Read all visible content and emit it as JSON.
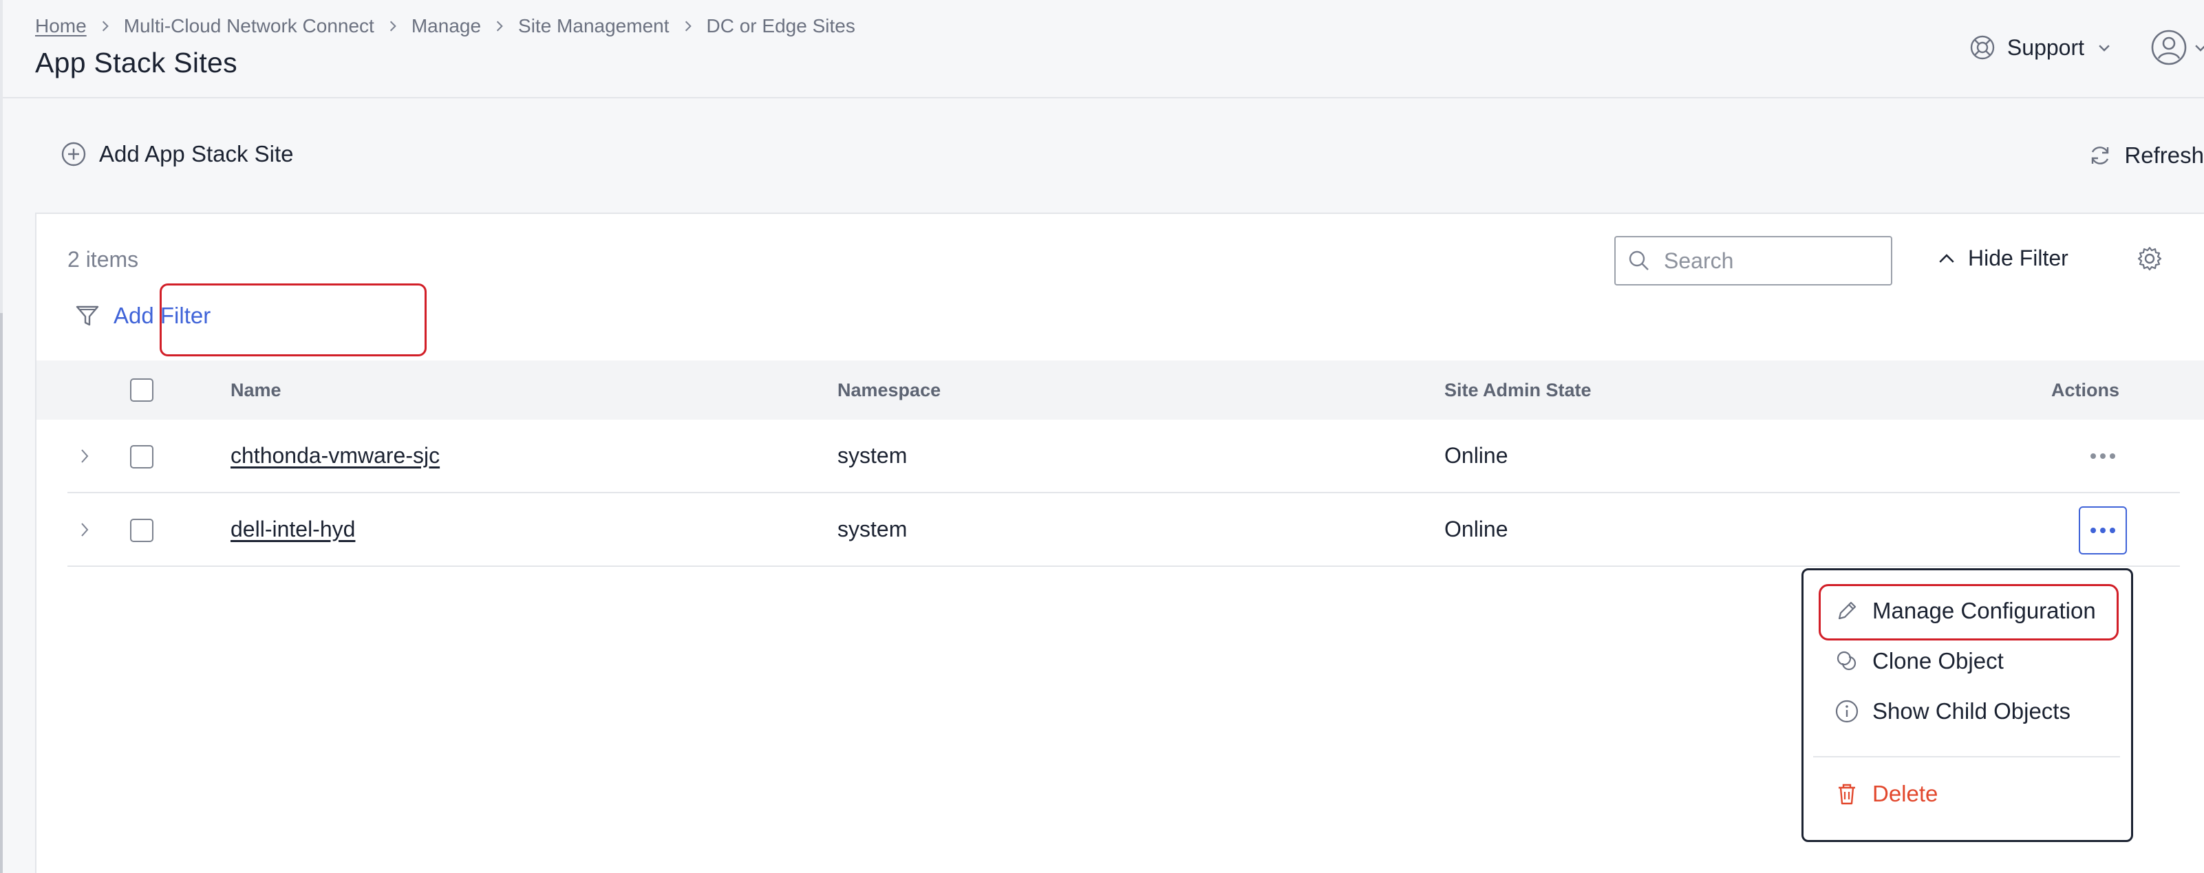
{
  "breadcrumb": {
    "items": [
      "Home",
      "Multi-Cloud Network Connect",
      "Manage",
      "Site Management",
      "DC or Edge Sites"
    ]
  },
  "page": {
    "title": "App Stack Sites"
  },
  "header": {
    "support_label": "Support"
  },
  "toolbar": {
    "add_label": "Add App Stack Site",
    "refresh_label": "Refresh"
  },
  "list": {
    "count_label": "2 items",
    "search_placeholder": "Search",
    "hide_filter_label": "Hide Filter",
    "add_filter_label": "Add Filter"
  },
  "table": {
    "columns": [
      "Name",
      "Namespace",
      "Site Admin State",
      "Actions"
    ],
    "rows": [
      {
        "name": "chthonda-vmware-sjc",
        "namespace": "system",
        "state": "Online"
      },
      {
        "name": "dell-intel-hyd",
        "namespace": "system",
        "state": "Online"
      }
    ]
  },
  "menu": {
    "items": [
      "Manage Configuration",
      "Clone Object",
      "Show Child Objects",
      "Delete"
    ]
  },
  "colors": {
    "accent": "#3f63d8",
    "danger": "#e2482d",
    "highlight": "#d21f28"
  }
}
